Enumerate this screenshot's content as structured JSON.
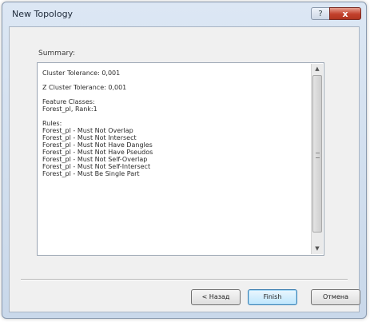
{
  "window": {
    "title": "New Topology",
    "help_label": "?",
    "close_label": "x"
  },
  "summary": {
    "label": "Summary:",
    "paragraphs": [
      [
        "Cluster Tolerance: 0,001"
      ],
      [
        "Z Cluster Tolerance: 0,001"
      ],
      [
        "Feature Classes:",
        "Forest_pl, Rank:1"
      ],
      [
        "Rules:",
        "Forest_pl - Must Not Overlap",
        "Forest_pl - Must Not Intersect",
        "Forest_pl - Must Not Have Dangles",
        "Forest_pl - Must Not Have Pseudos",
        "Forest_pl - Must Not Self-Overlap",
        "Forest_pl - Must Not Self-Intersect",
        "Forest_pl - Must Be Single Part"
      ]
    ]
  },
  "buttons": {
    "back": "< Назад",
    "finish": "Finish",
    "cancel": "Отмена"
  },
  "colors": {
    "title_bar": "#dce7f4",
    "close_button": "#c2402c",
    "default_button": "#bee6fd"
  }
}
